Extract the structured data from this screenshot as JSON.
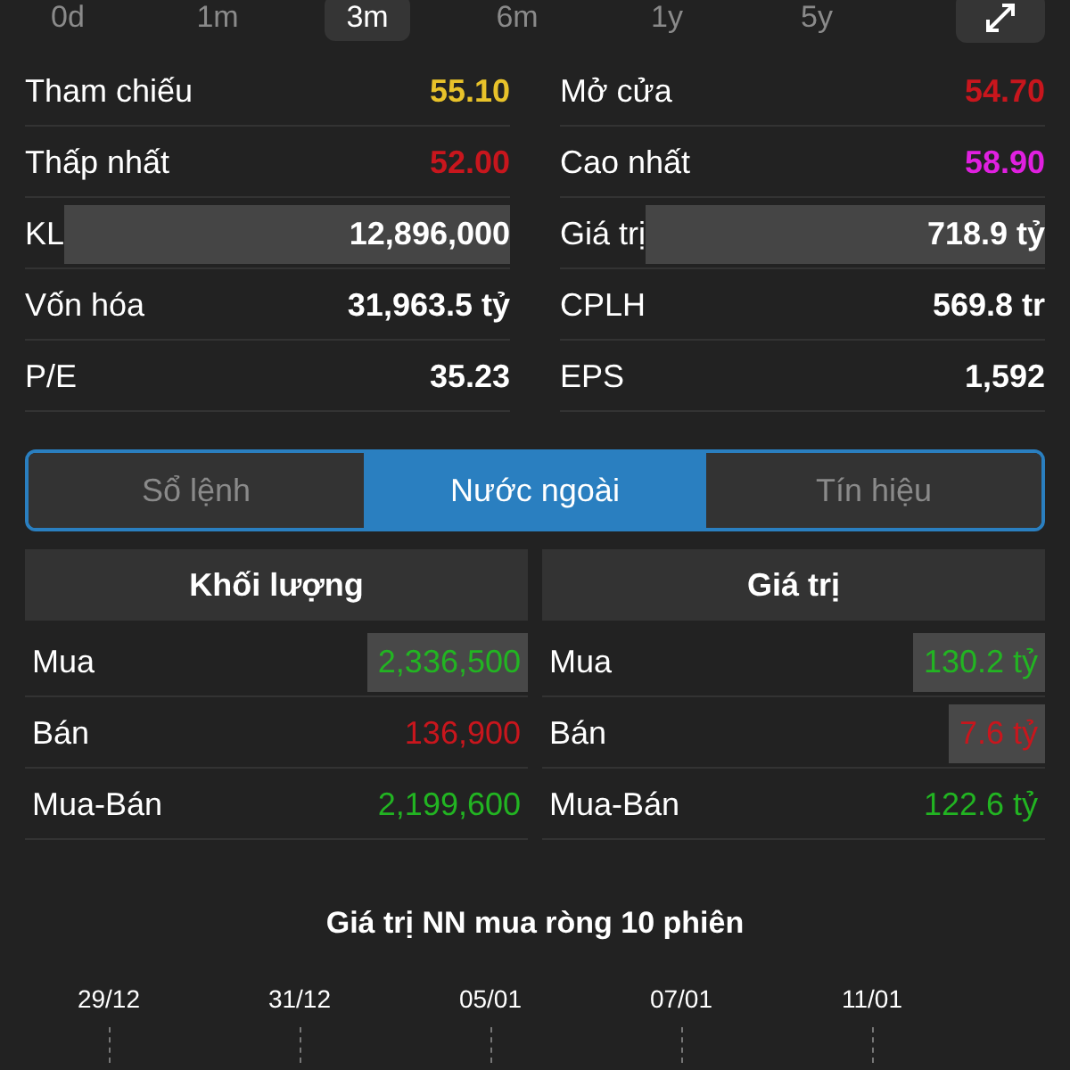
{
  "periods": [
    {
      "label": "0d",
      "selected": false
    },
    {
      "label": "1m",
      "selected": false
    },
    {
      "label": "3m",
      "selected": true
    },
    {
      "label": "6m",
      "selected": false
    },
    {
      "label": "1y",
      "selected": false
    },
    {
      "label": "5y",
      "selected": false
    }
  ],
  "stats": [
    {
      "label": "Tham chiếu",
      "value": "55.10",
      "color": "#e8c22a",
      "highlighted": false
    },
    {
      "label": "Mở cửa",
      "value": "54.70",
      "color": "#c8161d",
      "highlighted": false
    },
    {
      "label": "Thấp nhất",
      "value": "52.00",
      "color": "#c8161d",
      "highlighted": false
    },
    {
      "label": "Cao nhất",
      "value": "58.90",
      "color": "#e020e0",
      "highlighted": false
    },
    {
      "label": "KL",
      "value": "12,896,000",
      "color": "#ffffff",
      "highlighted": true
    },
    {
      "label": "Giá trị",
      "value": "718.9 tỷ",
      "color": "#ffffff",
      "highlighted": true
    },
    {
      "label": "Vốn hóa",
      "value": "31,963.5 tỷ",
      "color": "#ffffff",
      "highlighted": false
    },
    {
      "label": "CPLH",
      "value": "569.8 tr",
      "color": "#ffffff",
      "highlighted": false
    },
    {
      "label": "P/E",
      "value": "35.23",
      "color": "#ffffff",
      "highlighted": false
    },
    {
      "label": "EPS",
      "value": "1,592",
      "color": "#ffffff",
      "highlighted": false
    }
  ],
  "tabs": [
    {
      "label": "Sổ lệnh",
      "selected": false
    },
    {
      "label": "Nước ngoài",
      "selected": true
    },
    {
      "label": "Tín hiệu",
      "selected": false
    }
  ],
  "tables": [
    {
      "header": "Khối lượng",
      "rows": [
        {
          "label": "Mua",
          "value": "2,336,500",
          "color": "#22b422",
          "highlighted": true
        },
        {
          "label": "Bán",
          "value": "136,900",
          "color": "#c8161d",
          "highlighted": false
        },
        {
          "label": "Mua-Bán",
          "value": "2,199,600",
          "color": "#22b422",
          "highlighted": false
        }
      ]
    },
    {
      "header": "Giá trị",
      "rows": [
        {
          "label": "Mua",
          "value": "130.2 tỷ",
          "color": "#22b422",
          "highlighted": true
        },
        {
          "label": "Bán",
          "value": "7.6 tỷ",
          "color": "#c8161d",
          "highlighted": true
        },
        {
          "label": "Mua-Bán",
          "value": "122.6 tỷ",
          "color": "#22b422",
          "highlighted": false
        }
      ]
    }
  ],
  "chart": {
    "title": "Giá trị NN mua ròng 10 phiên",
    "dates": [
      "29/12",
      "31/12",
      "05/01",
      "07/01",
      "11/01"
    ]
  }
}
